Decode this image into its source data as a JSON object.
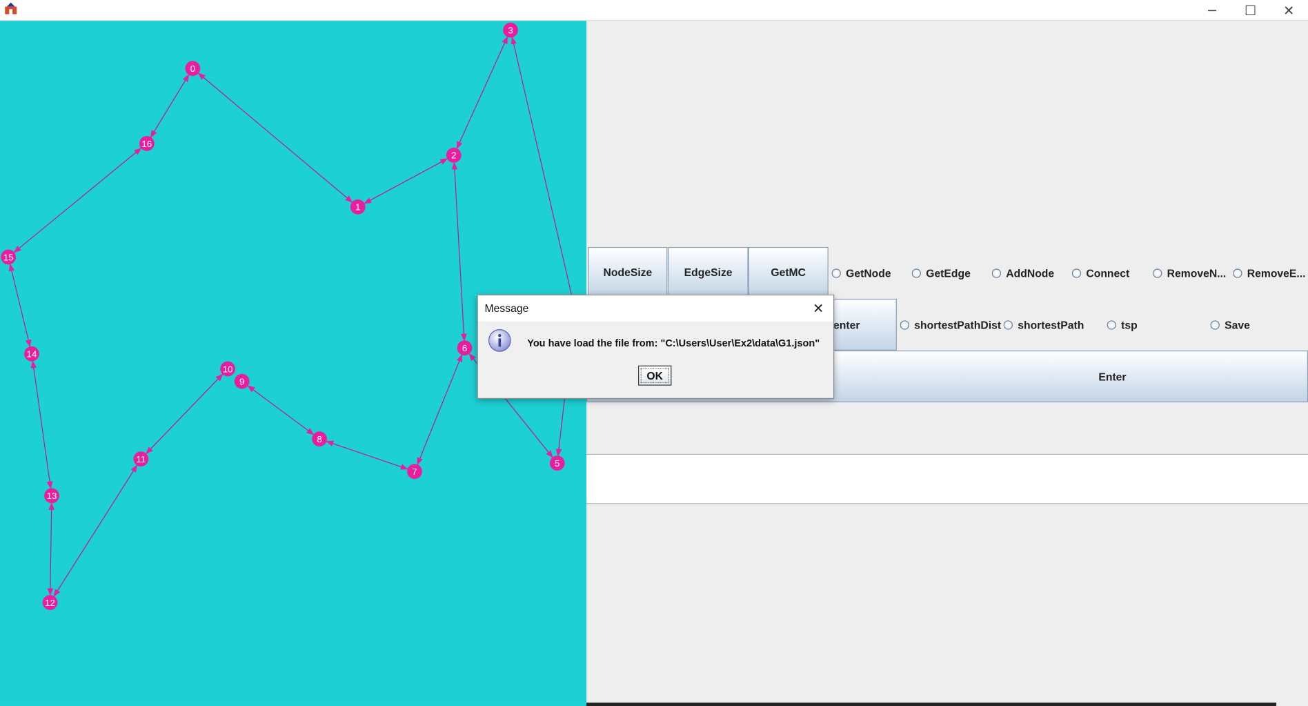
{
  "window": {
    "controls": {
      "minimize": "─",
      "maximize": "☐",
      "close": "✕"
    }
  },
  "graph": {
    "background": "#1dd0d3",
    "node_color": "#e91e9c",
    "nodes": [
      "0",
      "1",
      "2",
      "3",
      "5",
      "6",
      "7",
      "8",
      "9",
      "10",
      "11",
      "12",
      "13",
      "14",
      "15",
      "16"
    ]
  },
  "toolbar": {
    "row1_buttons": [
      "NodeSize",
      "EdgeSize",
      "GetMC"
    ],
    "row1_radios": [
      "GetNode",
      "GetEdge",
      "AddNode",
      "Connect",
      "RemoveN...",
      "RemoveE..."
    ],
    "row2_button": "enter",
    "row2_radios": [
      "shortestPathDist",
      "shortestPath",
      "tsp",
      "Save"
    ],
    "enter_button": "Enter"
  },
  "input": {
    "value": ""
  },
  "dialog": {
    "title": "Message",
    "close": "✕",
    "icon": "info-icon",
    "message": "You have load the file from: \"C:\\Users\\User\\Ex2\\data\\G1.json\"",
    "ok_label": "OK"
  },
  "colors": {
    "panel_bg": "#eeeeee",
    "canvas_bg": "#1dd0d3",
    "node": "#e91e9c",
    "edge": "#c0188a"
  }
}
